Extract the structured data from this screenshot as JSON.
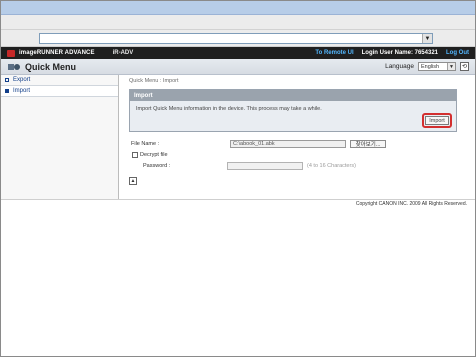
{
  "top": {
    "address_value": ""
  },
  "brand": {
    "product": "imageRUNNER ADVANCE",
    "device": "iR-ADV",
    "remote_ui": "To Remote UI",
    "login_user": "Login User Name: 7654321",
    "logout": "Log Out"
  },
  "header": {
    "title": "Quick Menu",
    "language_label": "Language",
    "language_value": "English"
  },
  "sidebar": {
    "items": [
      {
        "label": "Export"
      },
      {
        "label": "Import"
      }
    ]
  },
  "content": {
    "breadcrumb": "Quick Menu : Import",
    "panel_title": "Import",
    "panel_text": "Import Quick Menu information in the device. This process may take a while.",
    "import_button": "Import",
    "file_label": "File Name :",
    "file_value": "C:\\abook_01.abk",
    "browse_button": "찾아보기...",
    "decrypt_label": "Decrypt file",
    "password_label": "Password :",
    "password_hint": "(4 to 16 Characters)"
  },
  "footer": {
    "copyright": "Copyright CANON INC. 2009 All Rights Reserved."
  },
  "icons": {
    "dropdown": "chevron-down-icon",
    "refresh": "refresh-icon",
    "top": "arrow-up-icon"
  }
}
